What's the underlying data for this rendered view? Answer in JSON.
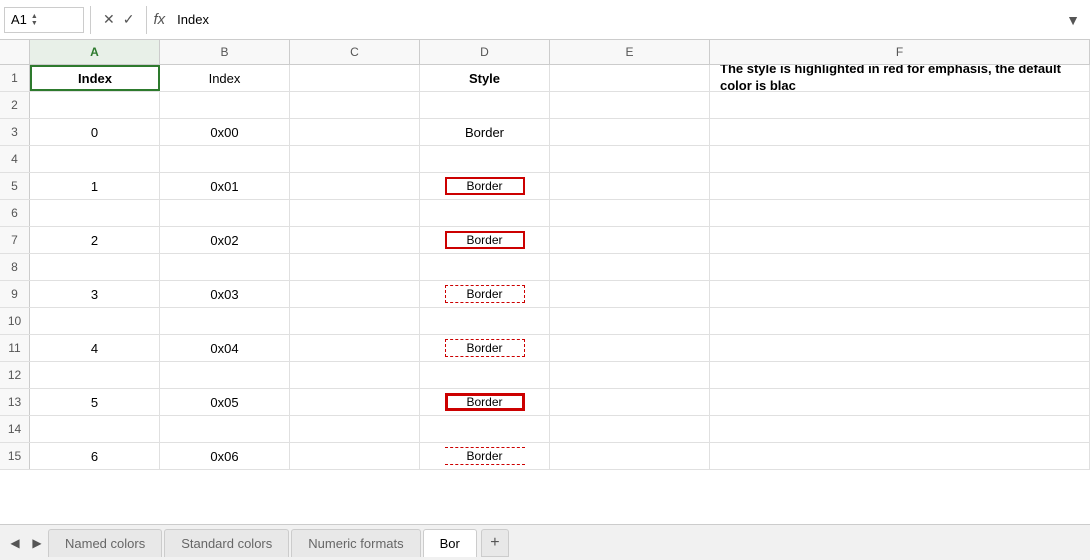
{
  "formula_bar": {
    "cell_ref": "A1",
    "formula_value": "Index",
    "fx_label": "fx",
    "cancel_icon": "✕",
    "confirm_icon": "✓"
  },
  "columns": [
    {
      "id": "A",
      "label": "A",
      "active": true
    },
    {
      "id": "B",
      "label": "B",
      "active": false
    },
    {
      "id": "C",
      "label": "C",
      "active": false
    },
    {
      "id": "D",
      "label": "D",
      "active": false
    },
    {
      "id": "E",
      "label": "E",
      "active": false
    },
    {
      "id": "F",
      "label": "F",
      "active": false
    }
  ],
  "rows": [
    {
      "row_num": "1",
      "cells": {
        "a": "Index",
        "b": "Index",
        "c": "",
        "d": "Style",
        "e": "",
        "f": ""
      },
      "a_bold": true,
      "d_bold": true,
      "note": "The style is highlighted in red for emphasis, the default color is blac"
    },
    {
      "row_num": "2",
      "cells": {
        "a": "",
        "b": "",
        "c": "",
        "d": "",
        "e": "",
        "f": ""
      }
    },
    {
      "row_num": "3",
      "cells": {
        "a": "0",
        "b": "0x00",
        "c": "",
        "d": "Border",
        "e": "",
        "f": ""
      },
      "d_style": "plain"
    },
    {
      "row_num": "4",
      "cells": {
        "a": "",
        "b": "",
        "c": "",
        "d": "",
        "e": "",
        "f": ""
      }
    },
    {
      "row_num": "5",
      "cells": {
        "a": "1",
        "b": "0x01",
        "c": "",
        "d": "Border",
        "e": "",
        "f": ""
      },
      "d_style": "solid-red"
    },
    {
      "row_num": "6",
      "cells": {
        "a": "",
        "b": "",
        "c": "",
        "d": "",
        "e": "",
        "f": ""
      }
    },
    {
      "row_num": "7",
      "cells": {
        "a": "2",
        "b": "0x02",
        "c": "",
        "d": "Border",
        "e": "",
        "f": ""
      },
      "d_style": "solid-red"
    },
    {
      "row_num": "8",
      "cells": {
        "a": "",
        "b": "",
        "c": "",
        "d": "",
        "e": "",
        "f": ""
      }
    },
    {
      "row_num": "9",
      "cells": {
        "a": "3",
        "b": "0x03",
        "c": "",
        "d": "Border",
        "e": "",
        "f": ""
      },
      "d_style": "dashed-red"
    },
    {
      "row_num": "10",
      "cells": {
        "a": "",
        "b": "",
        "c": "",
        "d": "",
        "e": "",
        "f": ""
      }
    },
    {
      "row_num": "11",
      "cells": {
        "a": "4",
        "b": "0x04",
        "c": "",
        "d": "Border",
        "e": "",
        "f": ""
      },
      "d_style": "dashed-red"
    },
    {
      "row_num": "12",
      "cells": {
        "a": "",
        "b": "",
        "c": "",
        "d": "",
        "e": "",
        "f": ""
      }
    },
    {
      "row_num": "13",
      "cells": {
        "a": "5",
        "b": "0x05",
        "c": "",
        "d": "Border",
        "e": "",
        "f": ""
      },
      "d_style": "thick-solid-red"
    },
    {
      "row_num": "14",
      "cells": {
        "a": "",
        "b": "",
        "c": "",
        "d": "",
        "e": "",
        "f": ""
      }
    },
    {
      "row_num": "15",
      "cells": {
        "a": "6",
        "b": "0x06",
        "c": "",
        "d": "Border",
        "e": "",
        "f": ""
      },
      "d_style": "partial-dashed"
    }
  ],
  "tabs": [
    {
      "id": "named-colors",
      "label": "Named colors",
      "active": false
    },
    {
      "id": "standard-colors",
      "label": "Standard colors",
      "active": false
    },
    {
      "id": "numeric-formats",
      "label": "Numeric formats",
      "active": false
    },
    {
      "id": "bor",
      "label": "Bor",
      "active": true
    }
  ],
  "add_tab_label": "+",
  "nav_prev": "◀",
  "nav_next": "▶"
}
